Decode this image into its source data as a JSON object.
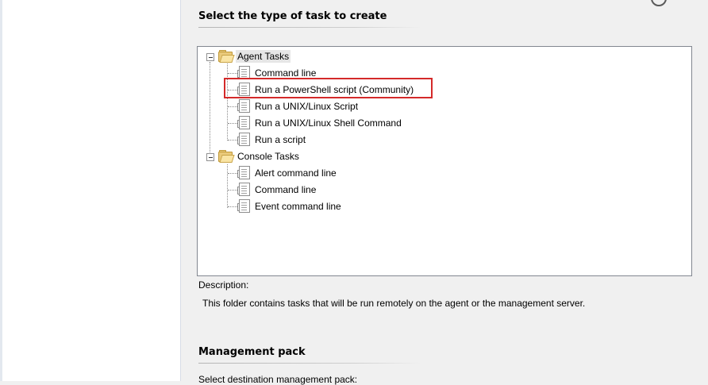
{
  "headings": {
    "task_type": "Select the type of task to create",
    "management_pack": "Management pack"
  },
  "tree": {
    "groups": [
      {
        "label": "Agent Tasks",
        "items": [
          "Command line",
          "Run a PowerShell script (Community)",
          "Run a UNIX/Linux Script",
          "Run a UNIX/Linux Shell Command",
          "Run a script"
        ]
      },
      {
        "label": "Console Tasks",
        "items": [
          "Alert command line",
          "Command line",
          "Event command line"
        ]
      }
    ],
    "selected": "Agent Tasks",
    "highlighted": "Run a PowerShell script (Community)"
  },
  "description": {
    "label": "Description:",
    "text": "This folder contains tasks that will be run remotely on the agent or the management server."
  },
  "management_pack": {
    "sublabel": "Select destination management pack:"
  },
  "colors": {
    "highlight_border": "#d42a2a",
    "selection_bg": "#e6e6e6",
    "dialog_bg": "#f0f0f0"
  }
}
